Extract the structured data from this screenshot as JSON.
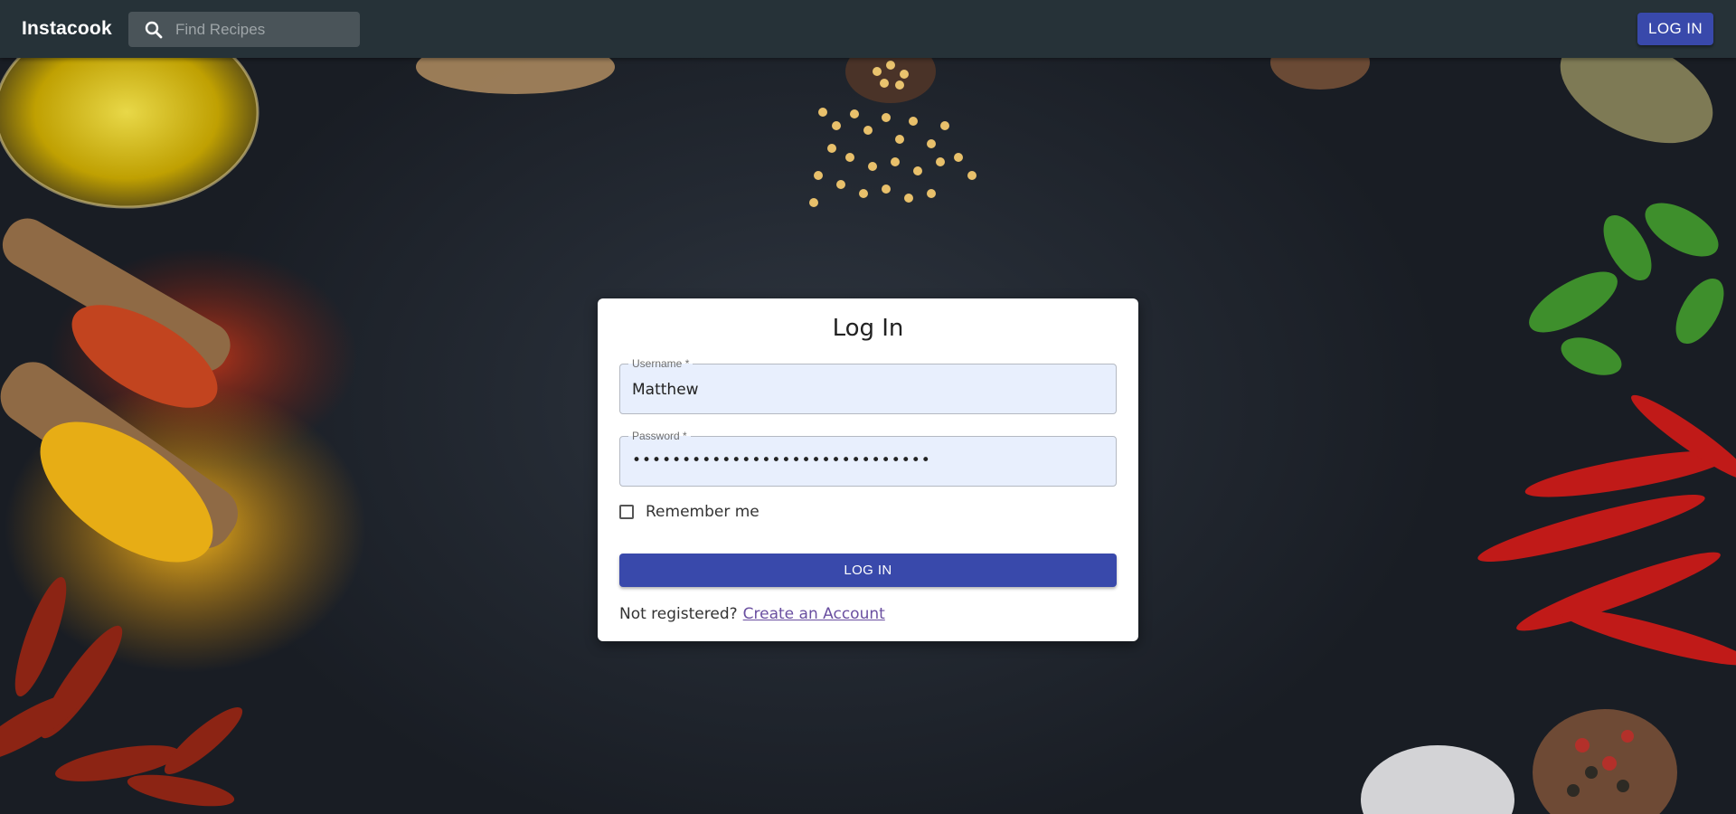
{
  "app": {
    "title": "Instacook",
    "colors": {
      "appbar": "#263238",
      "primary": "#3949ab",
      "link": "#6a4fa0"
    }
  },
  "header": {
    "search": {
      "placeholder": "Find Recipes",
      "icon": "search-icon"
    },
    "login_button": "LOG IN"
  },
  "login_form": {
    "title": "Log In",
    "username": {
      "label": "Username *",
      "value": "Matthew"
    },
    "password": {
      "label": "Password *",
      "value": "••••••••••••••••••••••••••••••"
    },
    "remember_me": {
      "label": "Remember me",
      "checked": false
    },
    "submit_label": "LOG IN",
    "register_prompt": "Not registered?",
    "register_link": "Create an Account"
  }
}
